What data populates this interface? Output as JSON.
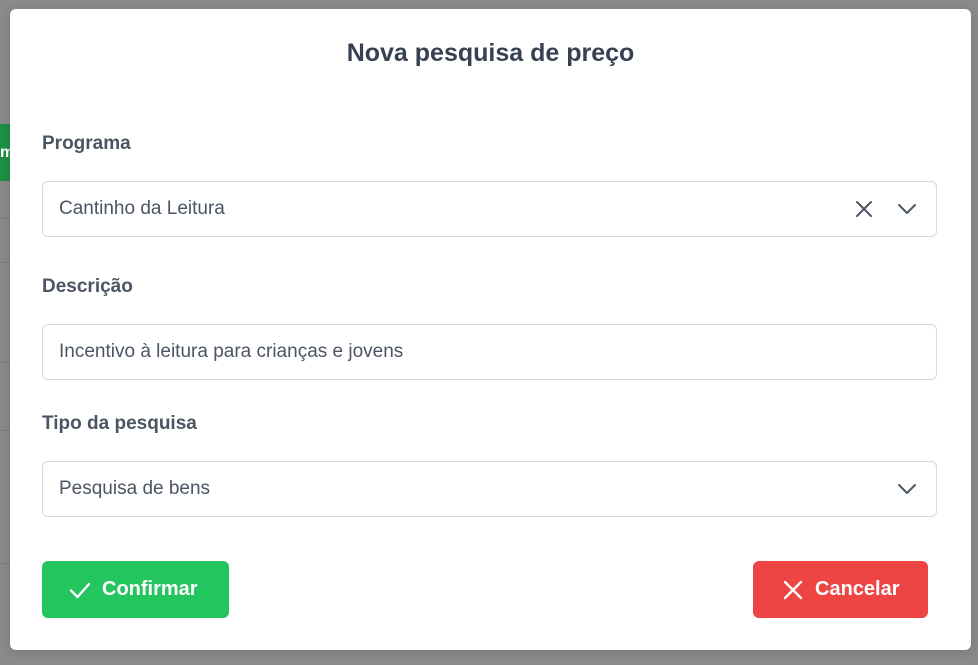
{
  "background": {
    "partial_button_text": "m"
  },
  "modal": {
    "title": "Nova pesquisa de preço",
    "fields": {
      "programa": {
        "label": "Programa",
        "value": "Cantinho da Leitura"
      },
      "descricao": {
        "label": "Descrição",
        "value": "Incentivo à leitura para crianças e jovens"
      },
      "tipo": {
        "label": "Tipo da pesquisa",
        "value": "Pesquisa de bens"
      }
    },
    "buttons": {
      "confirm_label": "Confirmar",
      "cancel_label": "Cancelar"
    }
  },
  "colors": {
    "confirm": "#22c55e",
    "cancel": "#ef4444",
    "text": "#374151",
    "border": "#d6d9de"
  },
  "icons": {
    "clear": "close-icon",
    "dropdown": "chevron-down-icon",
    "confirm": "check-icon",
    "cancel": "close-icon"
  }
}
